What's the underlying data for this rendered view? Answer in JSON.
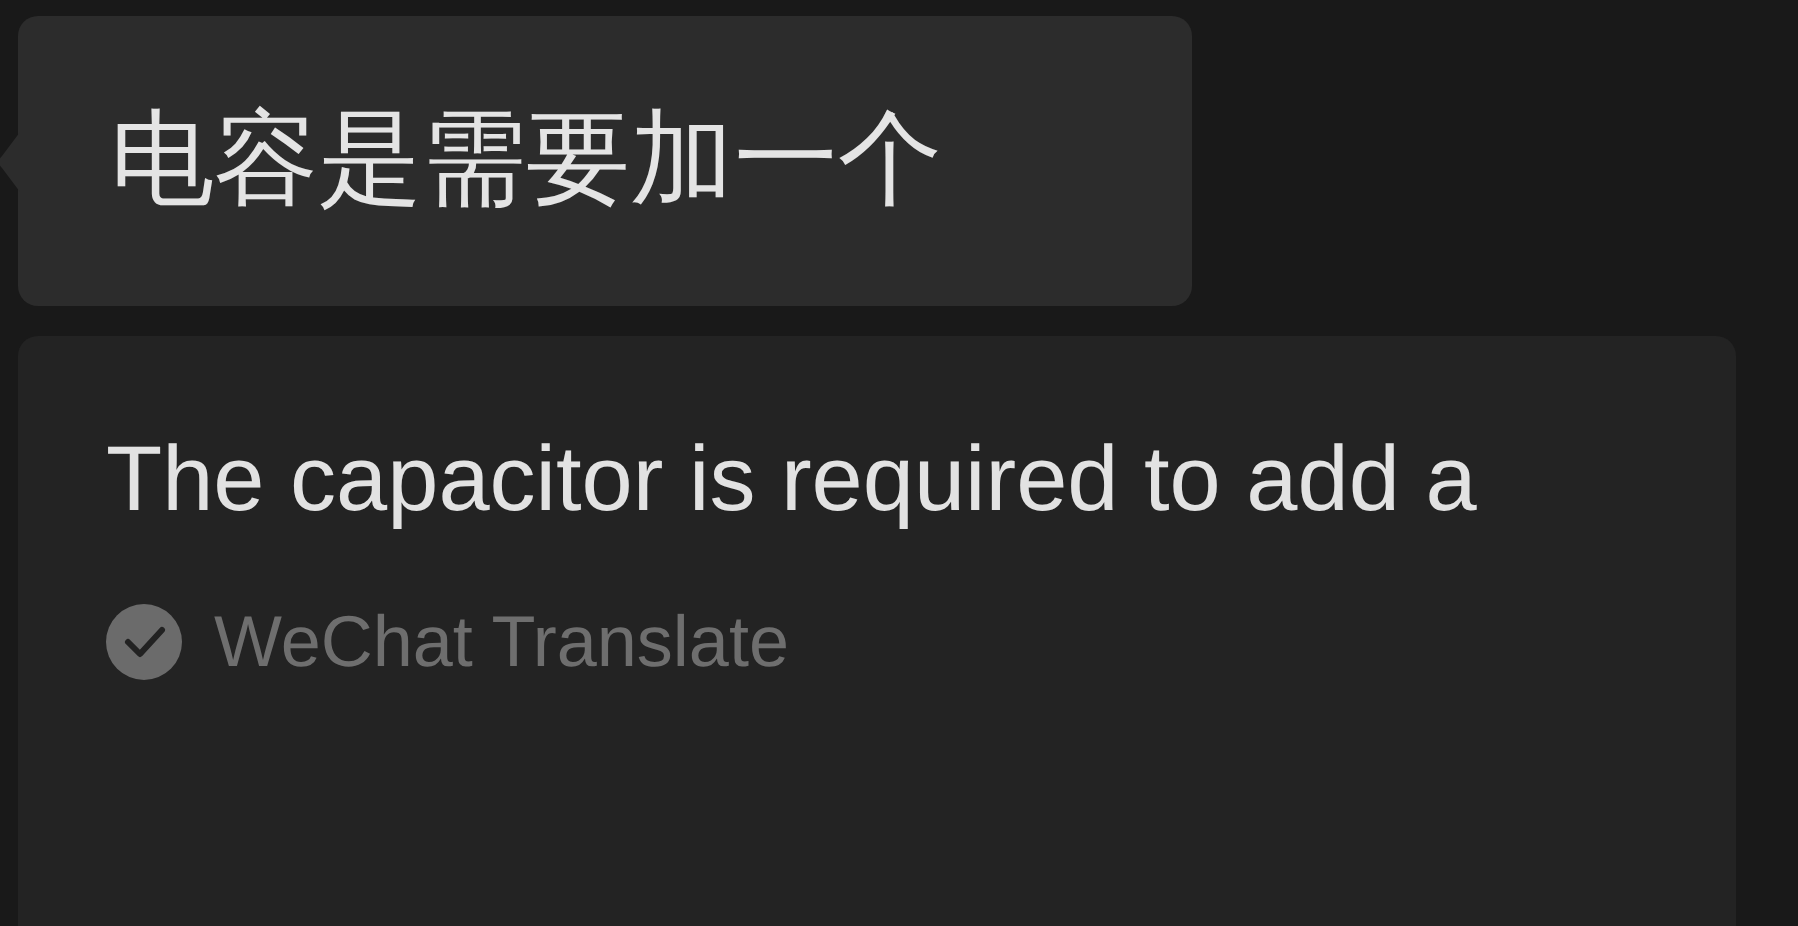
{
  "message": {
    "text": "电容是需要加一个"
  },
  "translation": {
    "text": "The capacitor is required to add a",
    "source": "WeChat Translate"
  }
}
